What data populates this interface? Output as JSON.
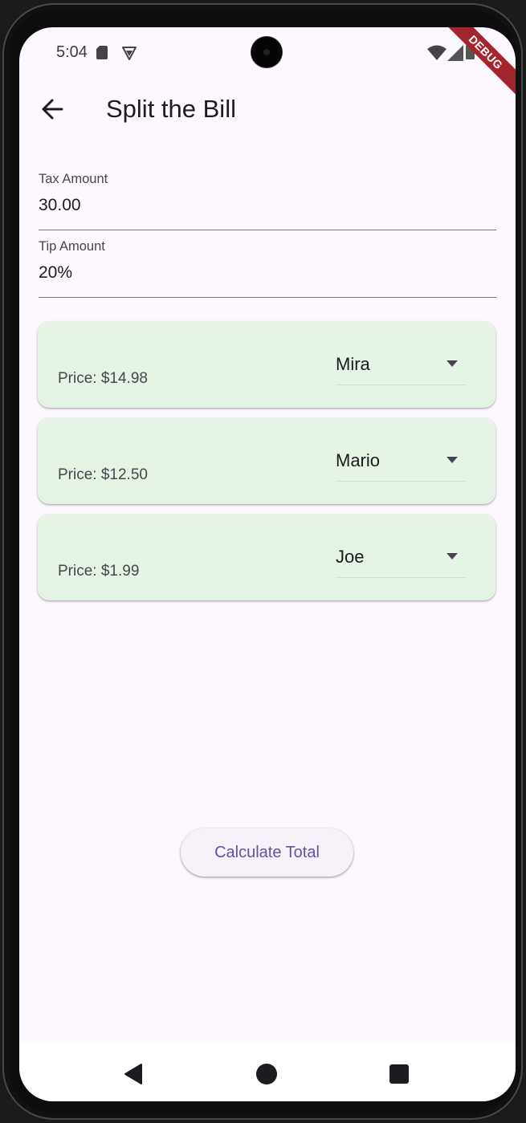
{
  "status_bar": {
    "time": "5:04",
    "icons": [
      "sd-card-icon",
      "shield-icon",
      "wifi-icon",
      "signal-icon",
      "battery-icon"
    ]
  },
  "debug_banner": "DEBUG",
  "app_bar": {
    "title": "Split the Bill",
    "back_icon": "arrow-left-icon"
  },
  "fields": {
    "tax": {
      "label": "Tax Amount",
      "value": "30.00"
    },
    "tip": {
      "label": "Tip Amount",
      "value": "20%"
    }
  },
  "items": [
    {
      "price": "Price: $14.98",
      "person": "Mira"
    },
    {
      "price": "Price: $12.50",
      "person": "Mario"
    },
    {
      "price": "Price: $1.99",
      "person": "Joe"
    }
  ],
  "calculate_button": {
    "label": "Calculate Total"
  },
  "nav_bar": {
    "icons": [
      "nav-back-icon",
      "nav-home-icon",
      "nav-recents-icon"
    ]
  },
  "colors": {
    "background": "#fdf7ff",
    "card": "#e6f4e6",
    "accent": "#6750a4",
    "debug": "#a3262d"
  }
}
